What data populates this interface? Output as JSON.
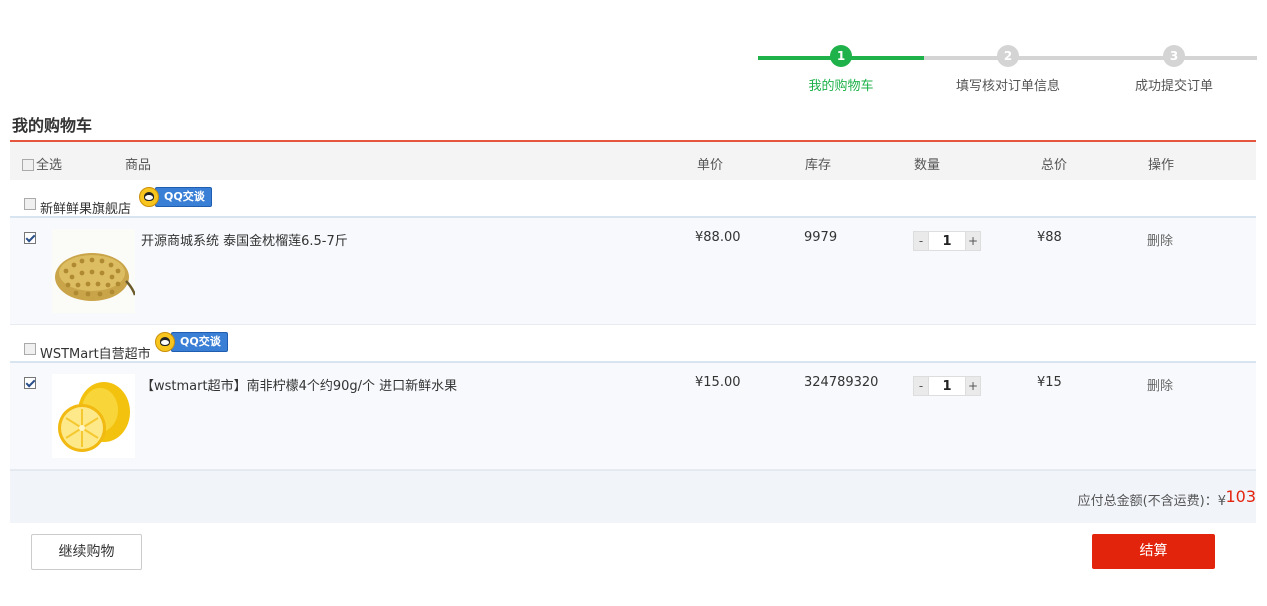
{
  "steps": [
    {
      "number": "1",
      "label": "我的购物车",
      "active": true
    },
    {
      "number": "2",
      "label": "填写核对订单信息",
      "active": false
    },
    {
      "number": "3",
      "label": "成功提交订单",
      "active": false
    }
  ],
  "page_title": "我的购物车",
  "header": {
    "select_all": "全选",
    "product": "商品",
    "unit_price": "单价",
    "stock": "库存",
    "quantity": "数量",
    "total": "总价",
    "action": "操作"
  },
  "qq_badge_text": "QQ交谈",
  "shops": [
    {
      "name": "新鲜鲜果旗舰店",
      "items": [
        {
          "name": "开源商城系统 泰国金枕榴莲6.5-7斤",
          "price": "¥88.00",
          "stock": "9979",
          "qty": "1",
          "total": "¥88",
          "delete": "删除",
          "checked": true,
          "thumb": "durian-image"
        }
      ]
    },
    {
      "name": "WSTMart自营超市",
      "items": [
        {
          "name": "【wstmart超市】南非柠檬4个约90g/个 进口新鲜水果",
          "price": "¥15.00",
          "stock": "324789320",
          "qty": "1",
          "total": "¥15",
          "delete": "删除",
          "checked": true,
          "thumb": "lemon-image"
        }
      ]
    }
  ],
  "summary": {
    "label": "应付总金额(不含运费)：¥",
    "amount": "103"
  },
  "buttons": {
    "continue": "继续购物",
    "checkout": "结算"
  },
  "colors": {
    "accent_green": "#1fb24a",
    "accent_red": "#e3240d",
    "header_line": "#e4563d"
  }
}
